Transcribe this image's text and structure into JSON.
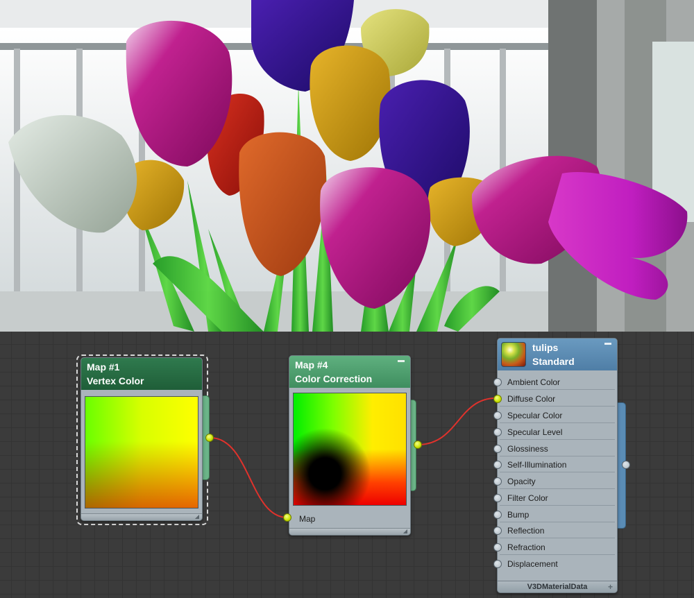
{
  "nodes": {
    "vertex_map": {
      "title": "Map #1",
      "subtitle": "Vertex Color",
      "selected": true
    },
    "color_correction": {
      "title": "Map #4",
      "subtitle": "Color Correction",
      "input_label": "Map",
      "minimize": "–"
    },
    "material": {
      "title": "tulips",
      "subtitle": "Standard",
      "minimize": "–",
      "slots": [
        "Ambient Color",
        "Diffuse Color",
        "Specular Color",
        "Specular Level",
        "Glossiness",
        "Self-Illumination",
        "Opacity",
        "Filter Color",
        "Bump",
        "Reflection",
        "Refraction",
        "Displacement"
      ],
      "connected_slot": "Diffuse Color",
      "footer": "V3DMaterialData",
      "footer_plus": "+"
    }
  },
  "colors": {
    "wire": "#e0322c",
    "socket_active": "#d4ec00",
    "header_map1": "#1f5e38",
    "header_map4": "#3f8e5f",
    "header_material": "#4f7ea6",
    "editor_bg": "#3b3b3b"
  },
  "icons": [
    "material-sphere-icon",
    "minimize-icon",
    "resize-grip-icon",
    "plus-icon"
  ]
}
